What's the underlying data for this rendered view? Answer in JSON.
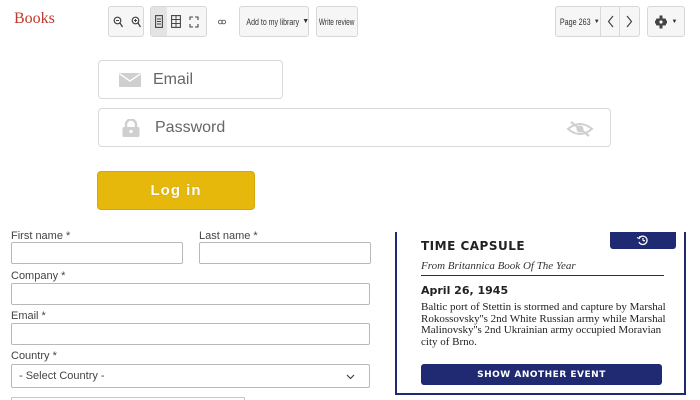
{
  "app": {
    "brand": "Books"
  },
  "toolbar": {
    "add_library_label": "Add to my library",
    "write_review_label": "Write review",
    "page_label": "Page 263",
    "icons": [
      "zoom-out-icon",
      "zoom-in-icon",
      "single-page-icon",
      "thumbnail-grid-icon",
      "fullscreen-icon",
      "link-icon",
      "chevron-left-icon",
      "chevron-right-icon",
      "gear-icon"
    ]
  },
  "login": {
    "email_placeholder": "Email",
    "password_placeholder": "Password",
    "button_label": "Log in",
    "button_color": "#e5b80b"
  },
  "register": {
    "first_name_label": "First name *",
    "last_name_label": "Last name *",
    "company_label": "Company *",
    "email_label": "Email *",
    "country_label": "Country *",
    "country_selected": "- Select Country -"
  },
  "time_capsule": {
    "title": "TIME CAPSULE",
    "subtitle": "From Britannica Book Of The Year",
    "date": "April 26, 1945",
    "text": "Baltic port of Stettin is stormed and capture by Marshal Rokossovsky''s 2nd White Russian army while Marshal Malinovsky''s 2nd Ukrainian army occupied Moravian city of Brno.",
    "button_label": "SHOW ANOTHER EVENT",
    "accent_color": "#1f2a72"
  }
}
